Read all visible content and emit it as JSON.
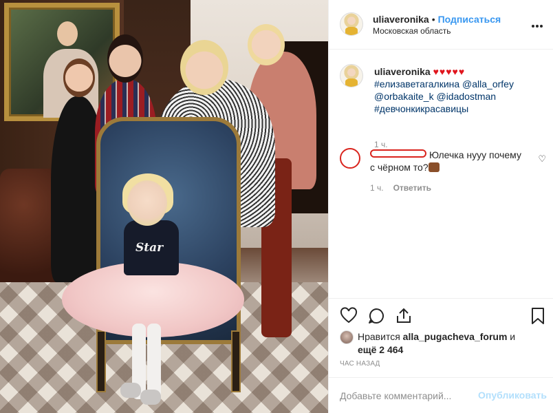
{
  "post": {
    "author": "uliaveronika",
    "dot": "•",
    "follow_label": "Подписаться",
    "location": "Московская область"
  },
  "photo": {
    "shirt_text": "Star"
  },
  "caption": {
    "author": "uliaveronika",
    "hearts": "♥♥♥♥♥",
    "line1": "#елизаветагалкина @alla_orfey",
    "line2": "@orbakaite_k @idadostman",
    "line3": "#девчонкикрасавицы",
    "time": "1 ч."
  },
  "comment": {
    "text": "Юлечка нууу почему с чёрном то?",
    "time": "1 ч.",
    "reply_label": "Ответить"
  },
  "likes": {
    "prefix": "Нравится",
    "user": "alla_pugacheva_forum",
    "conj": "и",
    "more": "ещё 2 464"
  },
  "timeago": "ЧАС НАЗАД",
  "add_comment": {
    "placeholder": "Добавьте комментарий...",
    "post_label": "Опубликовать"
  },
  "icons": {
    "like": "heart-icon",
    "comment": "comment-icon",
    "share": "share-icon",
    "save": "bookmark-icon",
    "more": "more-icon"
  },
  "colors": {
    "link": "#3897f0",
    "hashtag": "#003569",
    "hearts": "#e0161e",
    "redaction": "#d9241d",
    "muted": "#8e8e8e"
  }
}
